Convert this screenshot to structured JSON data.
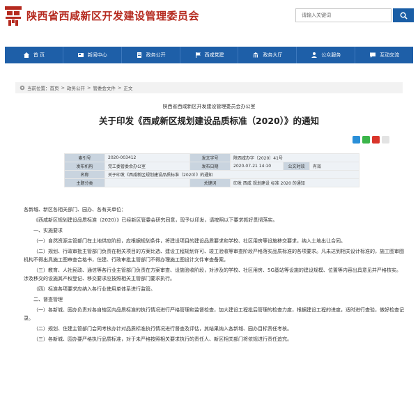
{
  "header": {
    "site_title": "陕西省西咸新区开发建设管理委员会",
    "search_placeholder": "请输入关键词",
    "accent": "#1e5fa8",
    "brand_red": "#b52a1f"
  },
  "nav": [
    {
      "label": "首 页",
      "icon": "home-icon"
    },
    {
      "label": "新闻中心",
      "icon": "news-icon"
    },
    {
      "label": "政务公开",
      "icon": "document-icon"
    },
    {
      "label": "西咸党建",
      "icon": "party-flag-icon"
    },
    {
      "label": "政务大厅",
      "icon": "hall-icon"
    },
    {
      "label": "公众服务",
      "icon": "people-icon"
    },
    {
      "label": "互动交流",
      "icon": "chat-icon"
    }
  ],
  "breadcrumb": {
    "prefix": "当前位置：",
    "items": [
      "首页",
      "政务公开",
      "管委会文件",
      "正文"
    ]
  },
  "article": {
    "office": "陕西省西咸新区开发建设管理委员会办公室",
    "title": "关于印发《西咸新区规划建设品质标准（2020）》的通知"
  },
  "info": {
    "index_label": "索引号",
    "index": "2020-003412",
    "docno_label": "发文字号",
    "docno": "陕西咸办字〔2020〕41号",
    "org_label": "发布机构",
    "org": "党工委管委会办公室",
    "date_label": "发布日期",
    "date": "2020-07-21 14:10",
    "status_label": "公文时效",
    "status": "有效",
    "name_label": "名称",
    "name": "关于印发《西咸新区规划建设品质标准（2020）》的通知",
    "topic_label": "主题分类",
    "topic": "",
    "kw_label": "关键词",
    "kw": "印发 西咸 规划建设 标准 2020 的通知"
  },
  "body": [
    "各新城、新区各相关部门、园办、各有关单位：",
    "《西咸新区规划建设品质标准（2020）》已经新区管委会研究同意，现予以印发，请按照以下要求抓好贯彻落实。",
    "一、实施要求",
    "（一）自然资源主管部门在土地供应阶段，应根据规划条件，将建设项目的建设品质要求和学校、社区用房等设施移交要求，纳入土地出让合同。",
    "（二）规划、行政审批主管部门负责在相关项目的方案比选、建设工程规划许可、竣工验收等审查阶段严格落实品质标准的各项要求。凡未达到相关设计标准的，施工图审图机构不得出具施工图审查合格书，住建、行政审批主管部门不得办理施工图设计文件审查备案。",
    "（三）教育、人社民政、通信等各行业主管部门负责在方案审查、设施验收阶段，对涉及的学校、社区用房、5G基站等设施的建设规模、位置等内容出具意见并严格核实。涉及移交的设施其产权登记、移交要求应按照相关主管部门要求执行。",
    "（四）标准各项要求应纳入各行业使用单体系进行监管。",
    "二、督查管理",
    "（一）各新城、园办负责对各自辖区内品质标准的执行情况进行严格管理和监督检查，加大建设工程批后管理的检查力度，根据建设工程的进度，适时进行查验，做好检查记录。",
    "（二）规划、住建主管部门会同考核办针对品质标准执行情况进行督查及评估，其结果纳入各新城、园办目标责任考核。",
    "（三）各新城、园办要严格执行品质标准，对于未严格按照相关要求执行的责任人、新区相关部门将依规进行责任追究。"
  ]
}
